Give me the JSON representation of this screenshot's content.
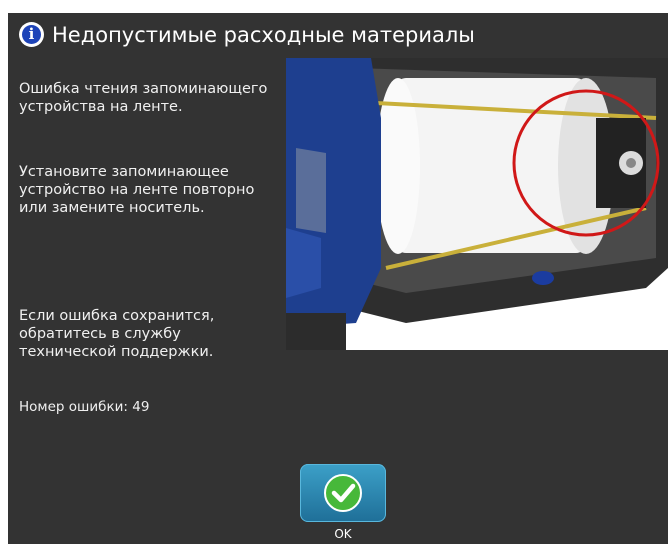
{
  "dialog": {
    "title": "Недопустимые расходные материалы",
    "icon": "info-icon",
    "messages": {
      "line1": "Ошибка чтения запоминающего устройства на ленте.",
      "line2": "Установите запоминающее устройство на ленте повторно или замените носитель.",
      "line3": "Если ошибка сохранится, обратитесь в службу технической поддержки."
    },
    "error_number": "Номер ошибки: 49",
    "ok_label": "OK",
    "ok_icon": "checkmark-icon"
  },
  "colors": {
    "background": "#333333",
    "accent_blue": "#1f6f98",
    "check_green": "#47b83a",
    "highlight_circle": "#d01818"
  }
}
